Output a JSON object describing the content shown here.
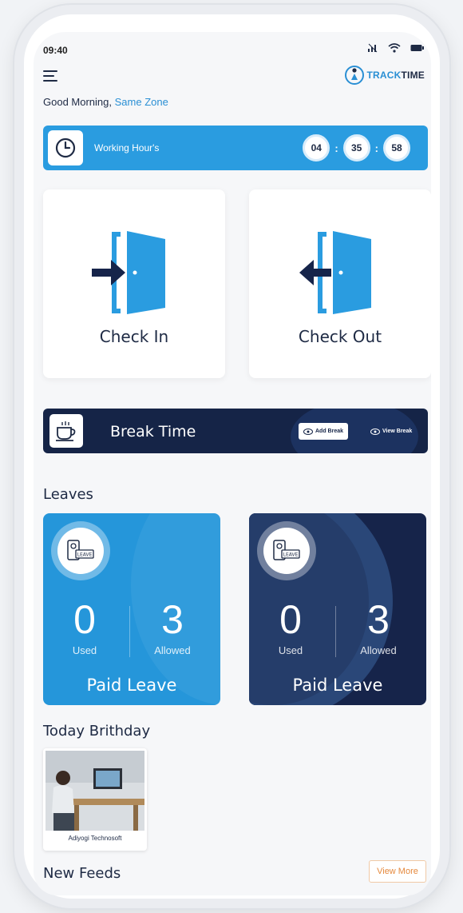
{
  "status_bar": {
    "time": "09:40"
  },
  "app": {
    "logo_prefix": "TRACK",
    "logo_suffix": "TIME"
  },
  "greeting": {
    "text": "Good Morning,",
    "name": "Same Zone"
  },
  "working_hours": {
    "label": "Working Hour's",
    "hours": "04",
    "minutes": "35",
    "seconds": "58"
  },
  "check_in": {
    "label": "Check In"
  },
  "check_out": {
    "label": "Check Out"
  },
  "break_time": {
    "title": "Break Time",
    "add_label": "Add Break",
    "view_label": "View Break"
  },
  "leaves": {
    "title": "Leaves",
    "cards": [
      {
        "used": "0",
        "used_label": "Used",
        "allowed": "3",
        "allowed_label": "Allowed",
        "name": "Paid Leave",
        "badge_text": "LEAVE"
      },
      {
        "used": "0",
        "used_label": "Used",
        "allowed": "3",
        "allowed_label": "Allowed",
        "name": "Paid Leave",
        "badge_text": "LEAVE"
      }
    ]
  },
  "birthday": {
    "title": "Today Brithday",
    "items": [
      {
        "name": "Adiyogi Technosoft"
      }
    ]
  },
  "feeds": {
    "title": "New Feeds",
    "view_more_label": "View More"
  },
  "colors": {
    "primary_blue": "#2596da",
    "navy": "#16244a",
    "accent_orange": "#e5893d"
  },
  "icons": [
    "menu-icon",
    "signal-icon",
    "wifi-icon",
    "battery-icon",
    "clock-icon",
    "door-enter-icon",
    "door-exit-icon",
    "coffee-cup-icon",
    "eye-icon",
    "leave-card-icon"
  ]
}
